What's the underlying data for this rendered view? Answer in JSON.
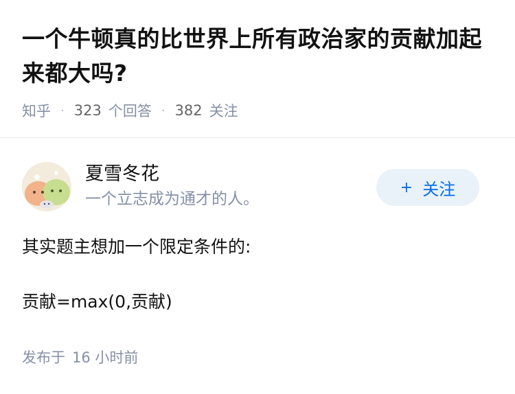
{
  "question": {
    "title": "一个牛顿真的比世界上所有政治家的贡献加起来都大吗?",
    "source": "知乎",
    "answers_count": "323",
    "answers_label": "个回答",
    "followers_count": "382",
    "followers_label": "关注",
    "separator": "·"
  },
  "author": {
    "name": "夏雪冬花",
    "bio": "一个立志成为通才的人。",
    "follow_plus": "+",
    "follow_label": "关注"
  },
  "answer": {
    "paragraphs": [
      "其实题主想加一个限定条件的:",
      "贡献=max(0,贡献)"
    ]
  },
  "publish": {
    "label": "发布于",
    "time": "16 小时前"
  },
  "colors": {
    "text": "#121212",
    "muted": "#8590a6",
    "accent": "#056de8",
    "button_bg": "#e9f1f9"
  }
}
